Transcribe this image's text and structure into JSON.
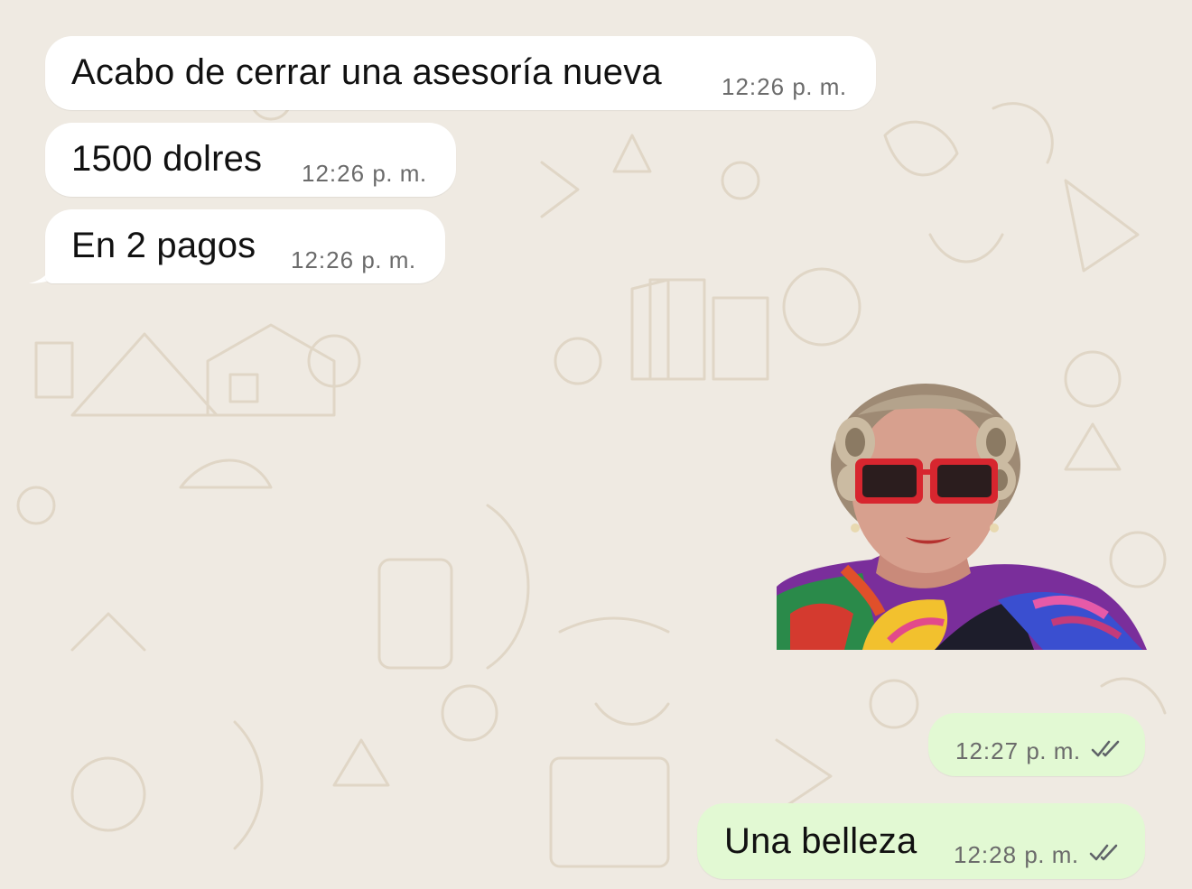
{
  "conversation": {
    "messages": [
      {
        "direction": "incoming",
        "text": "Acabo de cerrar una asesoría nueva",
        "time": "12:26",
        "ampm": "p. m."
      },
      {
        "direction": "incoming",
        "text": "1500 dolres",
        "time": "12:26",
        "ampm": "p. m."
      },
      {
        "direction": "incoming",
        "text": "En 2 pagos",
        "time": "12:26",
        "ampm": "p. m."
      },
      {
        "direction": "outgoing",
        "type": "sticker",
        "icon": "woman-with-red-sunglasses-sticker"
      },
      {
        "direction": "outgoing",
        "time": "12:27",
        "ampm": "p. m.",
        "status_icon": "double-check-icon"
      },
      {
        "direction": "outgoing",
        "text": "Una belleza",
        "time": "12:28",
        "ampm": "p. m.",
        "status_icon": "double-check-icon"
      }
    ]
  },
  "theme": {
    "background": "#efeae2",
    "incoming_bubble": "#ffffff",
    "outgoing_bubble": "#e2f9d3",
    "timestamp": "#6b6b6b",
    "tick": "#5f6368"
  }
}
